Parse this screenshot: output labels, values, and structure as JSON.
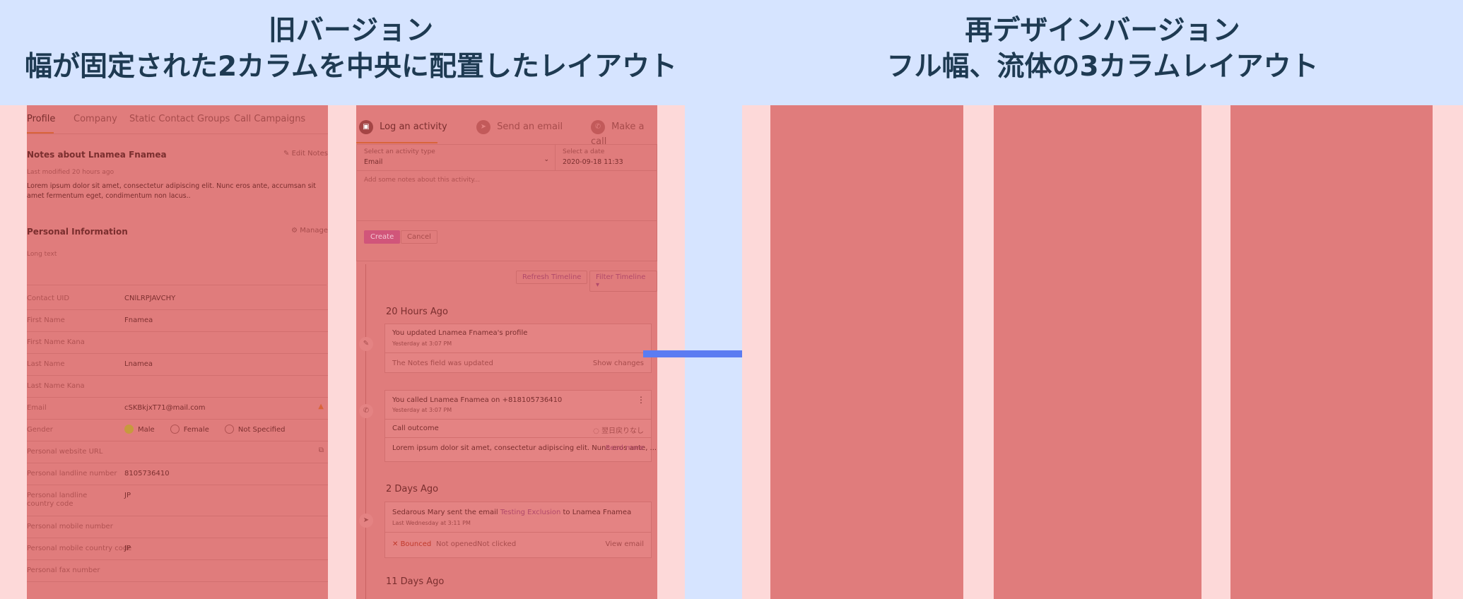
{
  "headings": {
    "left": {
      "line1": "旧バージョン",
      "line2": "幅が固定された2カラムを中央に配置したレイアウト"
    },
    "right": {
      "line1": "再デザインバージョン",
      "line2": "フル幅、流体の3カラムレイアウト"
    }
  },
  "colors": {
    "background": "#d6e4ff",
    "panel": "#fdd9d9",
    "overlay": "#e07c7c",
    "arrow": "#5b7cf2",
    "heading": "#1e3a52"
  },
  "old_ui": {
    "tabs": [
      "Profile",
      "Company",
      "Static Contact Groups",
      "Call Campaigns"
    ],
    "notes": {
      "title": "Notes about Lnamea Fnamea",
      "edit": "Edit Notes",
      "modified": "Last modified 20 hours ago",
      "body": "Lorem ipsum dolor sit amet, consectetur adipiscing elit. Nunc eros ante, accumsan sit amet fermentum eget, condimentum non lacus.."
    },
    "personal": {
      "title": "Personal Information",
      "manage": "Manage",
      "placeholder": "Long text"
    },
    "fields": [
      {
        "label": "Contact UID",
        "value": "CNlLRPJAVCHY"
      },
      {
        "label": "First Name",
        "value": "Fnamea"
      },
      {
        "label": "First Name Kana",
        "value": ""
      },
      {
        "label": "Last Name",
        "value": "Lnamea"
      },
      {
        "label": "Last Name Kana",
        "value": ""
      },
      {
        "label": "Email",
        "value": "cSKBkjxT71@mail.com"
      },
      {
        "label": "Gender",
        "value": ""
      },
      {
        "label": "Personal website URL",
        "value": ""
      },
      {
        "label": "Personal landline number",
        "value": "8105736410"
      },
      {
        "label": "Personal landline country code",
        "value": "JP"
      },
      {
        "label": "Personal mobile number",
        "value": ""
      },
      {
        "label": "Personal mobile country code",
        "value": "JP"
      },
      {
        "label": "Personal fax number",
        "value": ""
      }
    ],
    "gender_options": [
      "Male",
      "Female",
      "Not Specified"
    ],
    "activity_tabs": [
      "Log an activity",
      "Send an email",
      "Make a call"
    ],
    "activity_form": {
      "type_label": "Select an activity type",
      "type_value": "Email",
      "date_label": "Select a date",
      "date_value": "2020-09-18 11:33",
      "notes_placeholder": "Add some notes about this activity...",
      "create": "Create",
      "cancel": "Cancel"
    },
    "timeline_buttons": {
      "refresh": "Refresh Timeline",
      "filter": "Filter Timeline ▾"
    },
    "timeline": {
      "g1": "20 Hours Ago",
      "e1_title": "You updated Lnamea Fnamea's profile",
      "e1_time": "Yesterday at 3:07 PM",
      "e1_detail": "The Notes field was updated",
      "e1_link": "Show changes",
      "e2_title": "You called Lnamea Fnamea on +818105736410",
      "e2_time": "Yesterday at 3:07 PM",
      "e2_outcome_label": "Call outcome",
      "e2_outcome_value": "翌日戻りなし",
      "e2_body": "Lorem ipsum dolor sit amet, consectetur adipiscing elit. Nunc eros ante, ...",
      "e2_more": "Read more",
      "g2": "2 Days Ago",
      "e3_title_pre": "Sedarous Mary sent the email",
      "e3_link": "Testing Exclusion",
      "e3_title_post": "to Lnamea Fnamea",
      "e3_time": "Last Wednesday at 3:11 PM",
      "e3_bounced": "Bounced",
      "e3_opened": "Not opened",
      "e3_clicked": "Not clicked",
      "e3_view": "View email",
      "g3": "11 Days Ago"
    }
  }
}
